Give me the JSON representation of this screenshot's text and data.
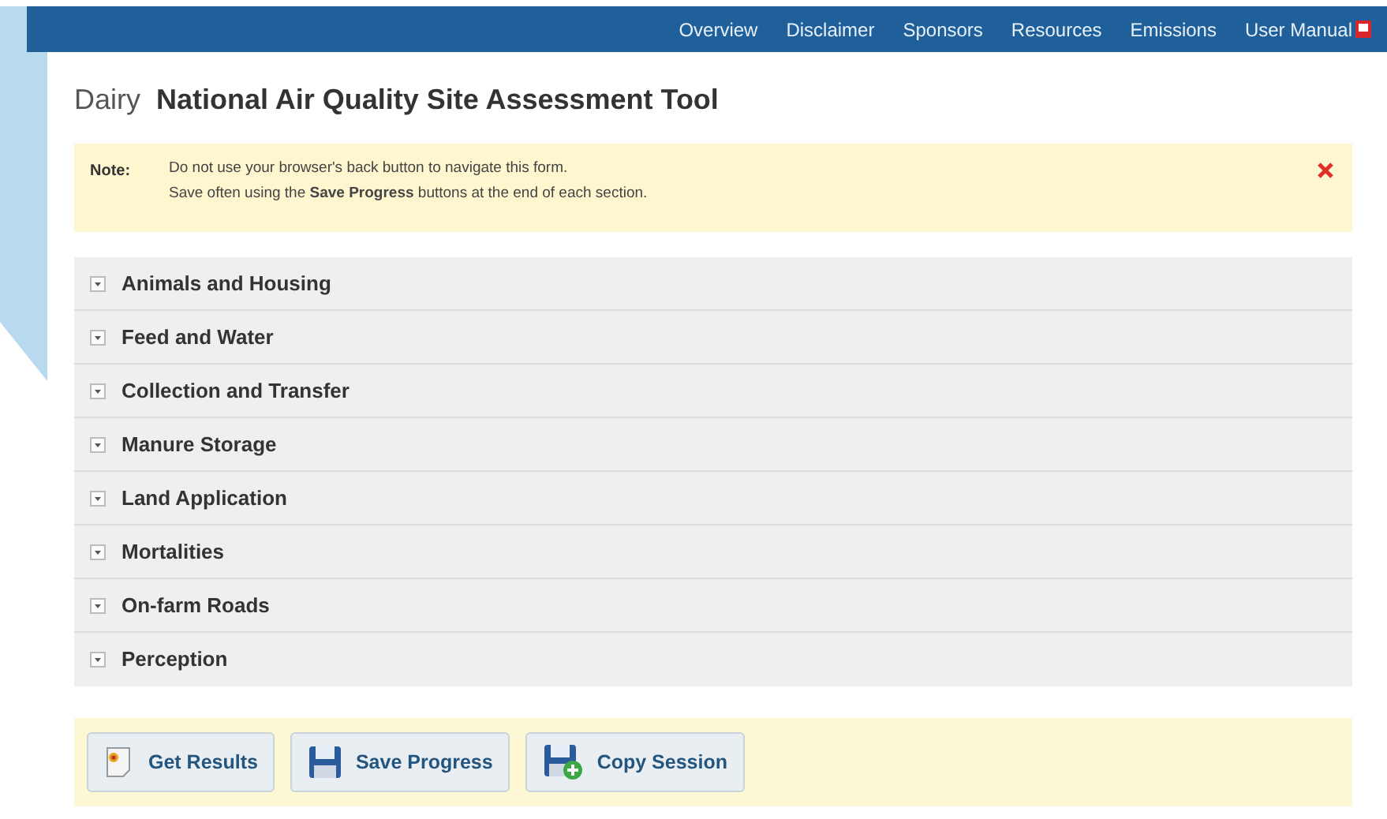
{
  "nav": [
    "Overview",
    "Disclaimer",
    "Sponsors",
    "Resources",
    "Emissions",
    "User Manual"
  ],
  "header": {
    "category": "Dairy",
    "title": "National Air Quality Site Assessment Tool"
  },
  "note": {
    "label": "Note:",
    "lines": [
      "Do not use your browser's back button to navigate this form.",
      "Save often using the **Save Progress** buttons at the end of each section."
    ]
  },
  "sections": [
    {
      "label": "Animals and Housing",
      "expanded": false
    },
    {
      "label": "Feed and Water",
      "expanded": false
    },
    {
      "label": "Collection and Transfer",
      "expanded": false
    },
    {
      "label": "Manure Storage",
      "expanded": false
    },
    {
      "label": "Land Application",
      "expanded": false
    },
    {
      "label": "Mortalities",
      "expanded": false
    },
    {
      "label": "On-farm Roads",
      "expanded": false
    },
    {
      "label": "Perception",
      "expanded": false
    }
  ],
  "buttons": [
    {
      "label": "Get Results",
      "kind": "results"
    },
    {
      "label": "Save Progress",
      "kind": "save"
    },
    {
      "label": "Copy Session",
      "kind": "copy"
    }
  ]
}
